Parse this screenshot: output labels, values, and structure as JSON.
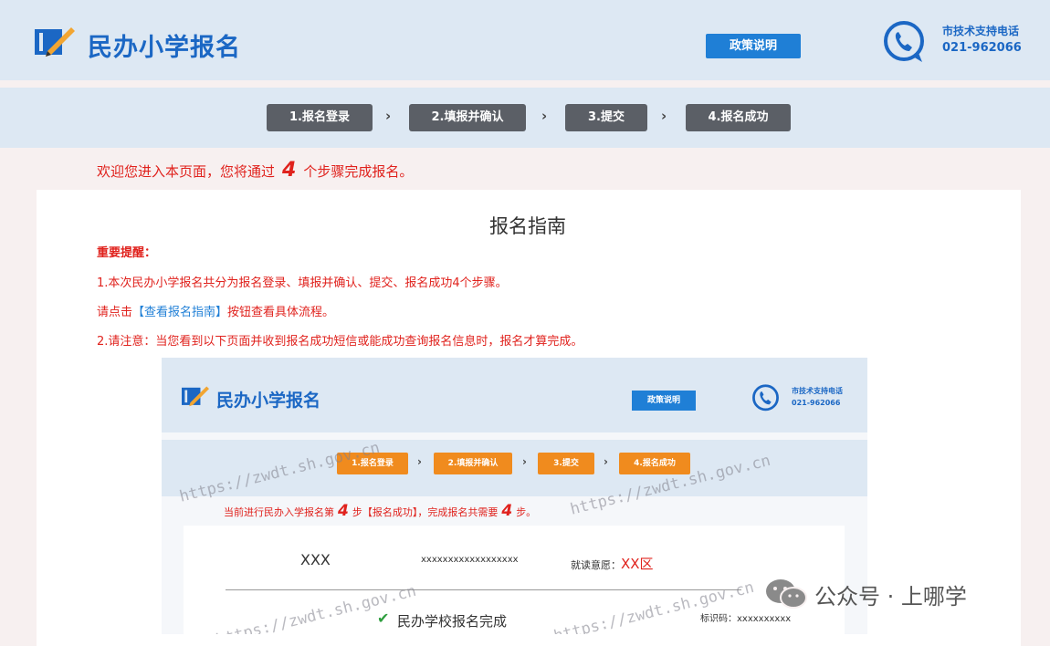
{
  "header": {
    "title": "民办小学报名",
    "policy_button": "政策说明",
    "support_label": "市技术支持电话",
    "support_phone": "021-962066"
  },
  "steps": [
    {
      "label": "1.报名登录"
    },
    {
      "label": "2.填报并确认"
    },
    {
      "label": "3.提交"
    },
    {
      "label": "4.报名成功"
    }
  ],
  "welcome": {
    "prefix": "欢迎您进入本页面，您将通过",
    "count": "4",
    "suffix": "个步骤完成报名。"
  },
  "guide": {
    "title": "报名指南",
    "important": "重要提醒：",
    "line1": "1.本次民办小学报名共分为报名登录、填报并确认、提交、报名成功4个步骤。",
    "line2_prefix": "请点击",
    "line2_link": "【查看报名指南】",
    "line2_suffix": "按钮查看具体流程。",
    "line3": "2.请注意：当您看到以下页面并收到报名成功短信或能成功查询报名信息时，报名才算完成。"
  },
  "example": {
    "title": "民办小学报名",
    "policy_button": "政策说明",
    "support_label": "市技术支持电话",
    "support_phone": "021-962066",
    "steps": [
      "1.报名登录",
      "2.填报并确认",
      "3.提交",
      "4.报名成功"
    ],
    "progress_prefix": "当前进行民办入学报名第",
    "progress_step": "4",
    "progress_mid": "步【报名成功】，完成报名共需要",
    "progress_total": "4",
    "progress_suffix": "步。",
    "name": "XXX",
    "id_number": "xxxxxxxxxxxxxxxxxx",
    "intent_label": "就读意愿：",
    "intent_value": "XX区",
    "status": "民办学校报名完成",
    "code_label": "标识码：",
    "code_value": "xxxxxxxxxx",
    "watermark": "https://zwdt.sh.gov.cn"
  },
  "wechat": {
    "text": "公众号 · 上哪学"
  },
  "colors": {
    "brand_blue": "#1b67c4",
    "button_blue": "#1f7fd6",
    "step_gray": "#5b5f66",
    "step_orange": "#f08b1e",
    "alert_red": "#e0221d",
    "header_bg": "#dde8f3"
  }
}
